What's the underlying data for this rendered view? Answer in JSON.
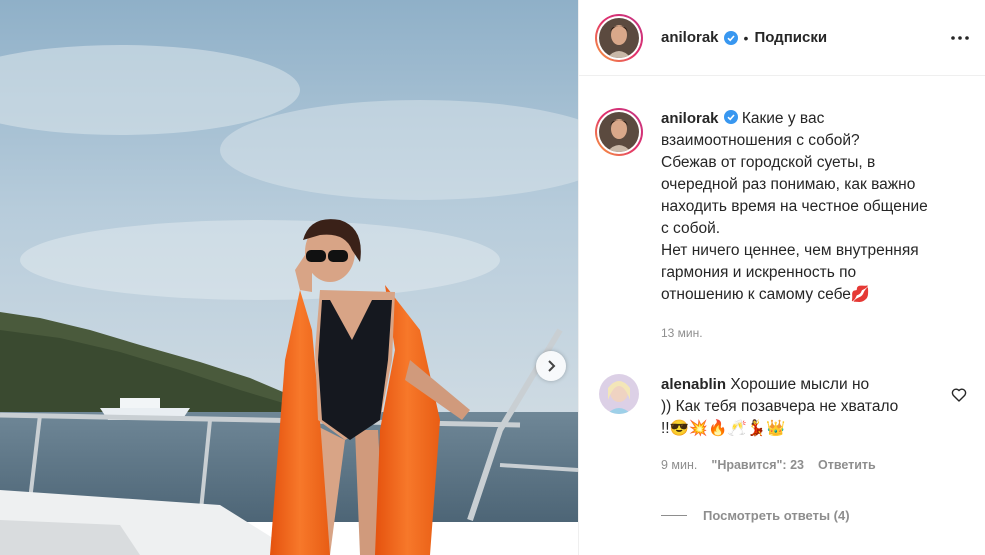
{
  "post": {
    "author": {
      "username": "anilorak",
      "verified_icon": "verified-badge-icon",
      "separator": "•",
      "follow_label": "Подписки"
    },
    "more_icon": "more-horizontal-icon",
    "next_icon": "chevron-right-icon",
    "caption": {
      "username": "anilorak",
      "lines": [
        "Какие у вас",
        "взаимоотношения с собой?",
        "Сбежав от городской суеты, в",
        "очередной раз понимаю, как важно",
        "находить время на честное общение",
        "с собой.",
        "Нет ничего ценнее, чем внутренняя",
        "гармония и искренность по",
        "отношению к самому себе💋"
      ],
      "timestamp": "13 мин."
    },
    "comment": {
      "username": "alenablin",
      "lines": [
        "Хорошие мысли но",
        ")) Как тебя позавчера не хватало",
        "!!😎💥🔥🥂💃👑"
      ],
      "timestamp": "9 мин.",
      "likes": "\"Нравится\": 23",
      "reply_label": "Ответить",
      "like_icon": "heart-outline-icon"
    },
    "view_replies_label": "Посмотреть ответы (4)"
  },
  "colors": {
    "text": "#262626",
    "muted": "#8e8e8e",
    "verified": "#3897f0",
    "robe": "#f26a1b"
  }
}
